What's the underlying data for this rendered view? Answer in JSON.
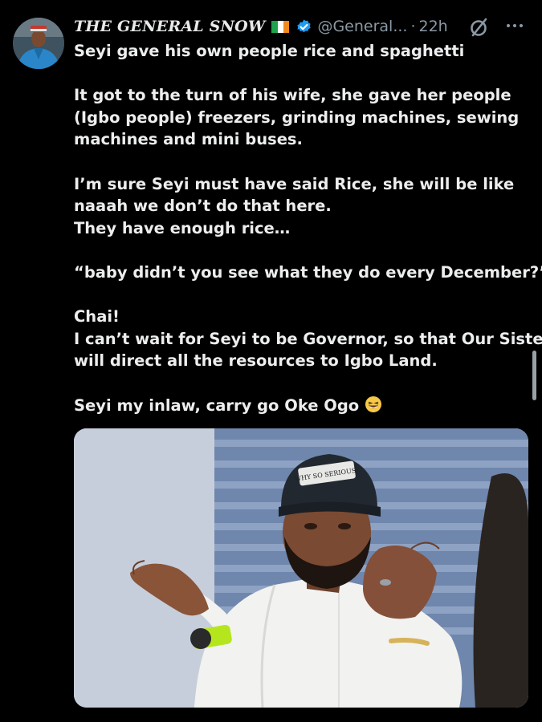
{
  "user": {
    "display_name": "THE GENERAL SNOW",
    "handle": "@General...",
    "separator": "·",
    "time": "22h",
    "flag_colors": [
      "#1fa34a",
      "#ffffff",
      "#f08a1c"
    ],
    "verified_color": "#1d9bf0"
  },
  "tweet": {
    "lines": [
      "Seyi  gave his own people rice and spaghetti",
      "",
      "It got to the turn of his wife, she gave her people",
      "(Igbo people) freezers, grinding machines, sewing",
      "machines and mini buses.",
      "",
      "I’m sure Seyi must have said Rice, she will be like",
      "naaah we don’t do that here.",
      "They have enough rice…",
      "",
      "“baby didn’t you see what they do every December?”",
      "",
      "Chai!",
      "I can’t wait for Seyi to be Governor, so that Our Sister",
      "will direct all the resources to Igbo Land.",
      "",
      "Seyi my inlaw, carry go Oke Ogo"
    ],
    "trailing_emoji": "grinning-squinting-face-emoji"
  },
  "media": {
    "cap_text": "WHY SO SERIOUS?",
    "description_icons": [
      "avatar",
      "verified-icon",
      "grok-icon",
      "more-options-icon"
    ]
  },
  "colors": {
    "background": "#000000",
    "text": "#e7e9ea",
    "secondary_text": "#8b98a5"
  }
}
